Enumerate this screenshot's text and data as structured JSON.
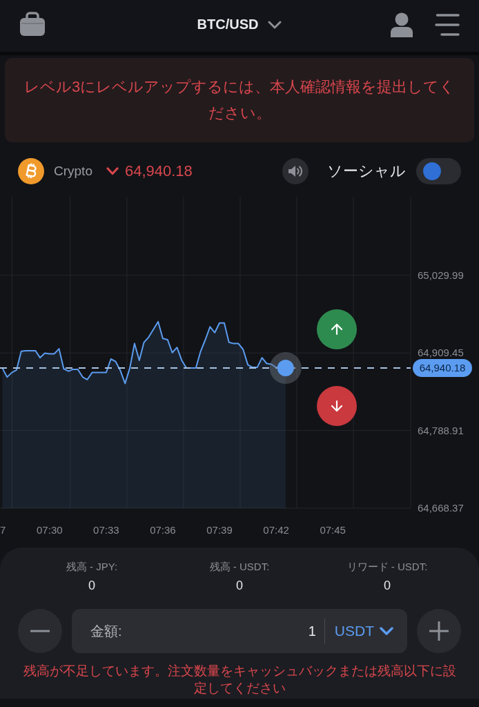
{
  "header": {
    "title": "BTC/USD"
  },
  "notice": {
    "text": "レベル3にレベルアップするには、本人確認情報を提出してください。"
  },
  "ticker": {
    "market": "Crypto",
    "falling": true,
    "price": "64,940.18",
    "social": {
      "label": "ソーシャル",
      "on": false
    }
  },
  "chart": {
    "price_tag": "64,940.18",
    "cut_axis_label": "7",
    "chart_data": {
      "type": "area",
      "grid": true,
      "categories": [
        null,
        null,
        null,
        null,
        null,
        null,
        null,
        null,
        null,
        null,
        "07:30",
        null,
        null,
        null,
        null,
        null,
        null,
        null,
        null,
        null,
        null,
        null,
        "07:33",
        null,
        null,
        null,
        null,
        null,
        null,
        null,
        null,
        null,
        null,
        null,
        "07:36",
        null,
        null,
        null,
        null,
        null,
        null,
        null,
        null,
        null,
        null,
        null,
        "07:39",
        null,
        null,
        null,
        null,
        null,
        null,
        null,
        null,
        null,
        null,
        null,
        "07:42",
        null,
        null,
        null,
        null,
        null,
        null,
        null,
        null,
        null,
        null,
        null,
        "07:45",
        null,
        null,
        null,
        null,
        null,
        null,
        null,
        null,
        null,
        null,
        null,
        null,
        null,
        null,
        null,
        null
      ],
      "series": [
        {
          "color": "#5b9cf0",
          "values": [
            64886,
            64872,
            64879,
            64883,
            64912,
            64913,
            64913,
            64913,
            64902,
            64909,
            64908,
            64908,
            64916,
            64885,
            64881,
            64884,
            64884,
            64872,
            64868,
            64879,
            64879,
            64879,
            64879,
            64900,
            64896,
            64882,
            64862,
            64886,
            64924,
            64898,
            64926,
            64934,
            64946,
            64958,
            64932,
            64930,
            64910,
            64918,
            64898,
            64886,
            64886,
            64886,
            64912,
            64930,
            64950,
            64941,
            64956,
            64956,
            64926,
            64924,
            64924,
            64915,
            64891,
            64887,
            64887,
            64902,
            64893,
            64892,
            64887,
            64886,
            64886,
            null,
            null,
            null,
            null,
            null,
            null,
            null,
            null,
            null,
            null,
            null,
            null,
            null,
            null,
            null,
            null,
            null,
            null,
            null,
            null,
            null,
            null,
            null,
            null,
            null,
            null
          ]
        }
      ],
      "ref_lines": [
        {
          "axis": "y",
          "value": 64886
        }
      ],
      "ylim": [
        64668.37,
        65152.0
      ],
      "yticks": [
        {
          "value": 65029.99,
          "label": "65,029.99"
        },
        {
          "value": 64909.45,
          "label": "64,909.45"
        },
        {
          "value": 64788.91,
          "label": "64,788.91"
        },
        {
          "value": 64668.37,
          "label": "64,668.37"
        }
      ]
    }
  },
  "balances": [
    {
      "label": "残高 - JPY:",
      "value": "0"
    },
    {
      "label": "残高 - USDT:",
      "value": "0"
    },
    {
      "label": "リワード - USDT:",
      "value": "0"
    }
  ],
  "amount": {
    "label": "金額:",
    "value": "1",
    "currency": "USDT"
  },
  "error": "残高が不足しています。注文数量をキャッシュバックまたは残高以下に設定してください"
}
